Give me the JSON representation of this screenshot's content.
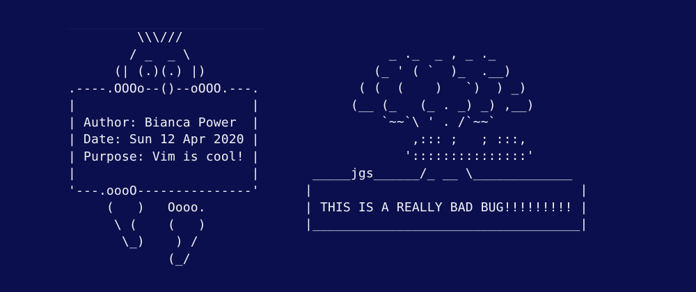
{
  "left_ascii_art": "         \\\\\\///\n        / _  _ \\\n      (| (.)(.) |)\n.----.OOOo--()--oOOO.---.\n|                       |\n| Author: Bianca Power  |\n| Date: Sun 12 Apr 2020 |\n| Purpose: Vim is cool! |\n|                       |\n'---.oooO---------------'\n     (   )   Oooo.\n      \\ (    (   )\n       \\_)    ) /\n             (_/",
  "right_ascii_art": "           _ ._  _ , _ ._\n         (_ ' ( `  )_  .__)\n       ( (  (    )   `)  ) _)\n      (__ (_   (_ . _) _) ,__)\n          `~~`\\ ' . /`~~`\n              ,::: ;   ; :::,\n             ':::::::::::::::'\n _____jgs______/_ __ \\_____________\n|                                   |\n| THIS IS A REALLY BAD BUG!!!!!!!!! |\n|___________________________________|"
}
